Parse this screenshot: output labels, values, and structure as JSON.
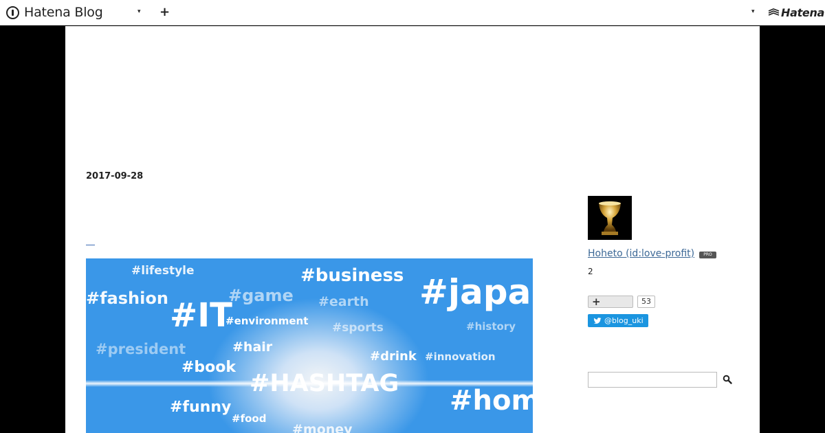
{
  "header": {
    "brand": "Hatena Blog",
    "dropdown_icon": "▾",
    "plus_label": "+",
    "right_dropdown_icon": "▾",
    "hatena_logo_text": "Hatena"
  },
  "entry": {
    "date": "2017-09-28",
    "hero_tags": [
      {
        "text": "#lifestyle"
      },
      {
        "text": "#business"
      },
      {
        "text": "#fashion"
      },
      {
        "text": "#game"
      },
      {
        "text": "#IT"
      },
      {
        "text": "#earth"
      },
      {
        "text": "#japan"
      },
      {
        "text": "#environment"
      },
      {
        "text": "#sports"
      },
      {
        "text": "#history"
      },
      {
        "text": "#president"
      },
      {
        "text": "#hair"
      },
      {
        "text": "#drink"
      },
      {
        "text": "#innovation"
      },
      {
        "text": "#book"
      },
      {
        "text": "#HASHTAG"
      },
      {
        "text": "#home"
      },
      {
        "text": "#funny"
      },
      {
        "text": "#food"
      },
      {
        "text": "#money"
      }
    ]
  },
  "sidebar": {
    "profile_name": "Hoheto (id:love-profit)",
    "pro_badge": "PRO",
    "follower_count": "2",
    "bookmark_label": "+",
    "bookmark_count": "53",
    "twitter_label": "@blog_uki",
    "search_placeholder": ""
  },
  "colors": {
    "link": "#3c6896",
    "twitter": "#1b95e0",
    "hero_blue": "#3a97e8"
  }
}
